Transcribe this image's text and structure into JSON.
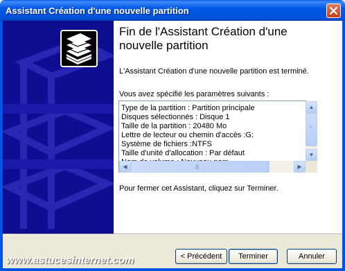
{
  "window": {
    "title": "Assistant Création d'une nouvelle partition",
    "close_icon": "close-icon"
  },
  "banner": {
    "icon": "disk-stack-icon"
  },
  "content": {
    "heading": "Fin de l'Assistant Création d'une nouvelle partition",
    "completed_text": "L'Assistant Création d'une nouvelle partition est terminé.",
    "params_label": "Vous avez spécifié les paramètres suivants :",
    "params": [
      "Type de la partition : Partition principale",
      "Disques sélectionnés : Disque 1",
      "Taille de la partition : 20480 Mo",
      "Lettre de lecteur ou chemin d'accès :G:",
      "Système de fichiers :NTFS",
      "Taille d'unité d'allocation : Par défaut",
      "Nom de volume : Nouveau nom"
    ],
    "close_instruction": "Pour fermer cet Assistant, cliquez sur Terminer."
  },
  "footer": {
    "back_label": "< Précédent",
    "finish_label": "Terminer",
    "cancel_label": "Annuler"
  },
  "watermark": "www.astucesinternet.com"
}
